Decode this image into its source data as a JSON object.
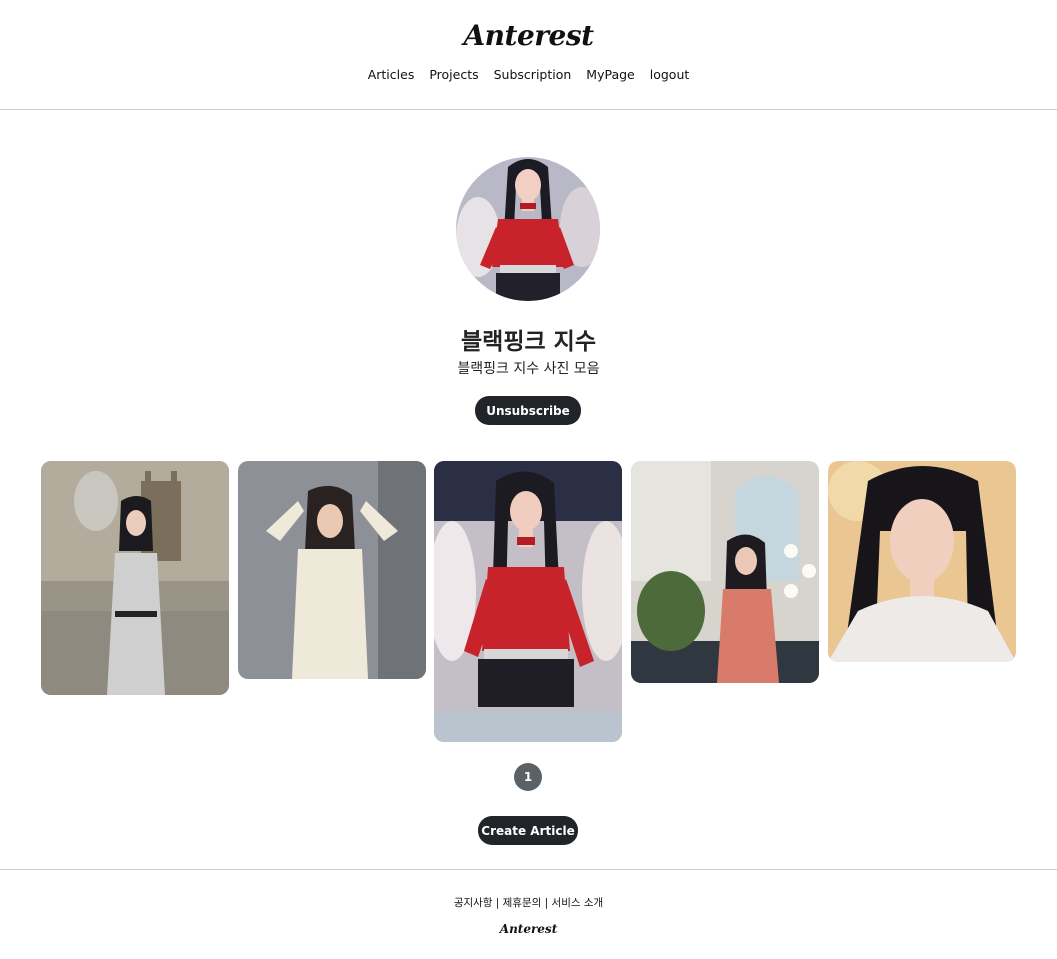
{
  "header": {
    "logo": "Anterest",
    "nav": [
      "Articles",
      "Projects",
      "Subscription",
      "MyPage",
      "logout"
    ]
  },
  "project": {
    "title": "블랙핑크 지수",
    "description": "블랙핑크 지수 사진 모음",
    "unsubscribe_label": "Unsubscribe"
  },
  "pagination": {
    "current": "1"
  },
  "actions": {
    "create_label": "Create Article"
  },
  "footer": {
    "links": [
      "공지사항",
      "제휴문의",
      "서비스 소개"
    ],
    "separator": " | ",
    "logo": "Anterest"
  },
  "colors": {
    "button_dark": "#212529",
    "page_button": "#5a6268",
    "divider": "#cfcfcf"
  }
}
